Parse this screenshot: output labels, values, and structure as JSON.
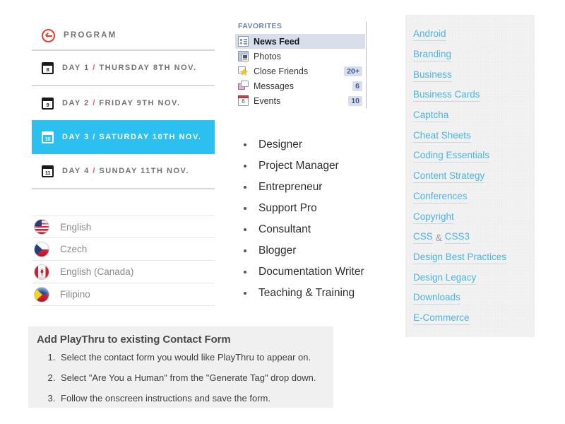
{
  "program": {
    "header": {
      "icon": "reply-arrow-circle-icon",
      "title": "PROGRAM"
    },
    "days": [
      {
        "num": "8",
        "day": "DAY 1",
        "sep": " / ",
        "date": "THURSDAY 8TH NOV.",
        "active": false
      },
      {
        "num": "9",
        "day": "DAY 2",
        "sep": " / ",
        "date": "FRIDAY 9TH NOV.",
        "active": false
      },
      {
        "num": "10",
        "day": "DAY 3",
        "sep": " / ",
        "date": "SATURDAY 10TH NOV.",
        "active": true
      },
      {
        "num": "11",
        "day": "DAY 4",
        "sep": " / ",
        "date": "SUNDAY 11TH NOV.",
        "active": false
      }
    ]
  },
  "languages": [
    {
      "name": "English",
      "flag": "flag-united-states-icon"
    },
    {
      "name": "Czech",
      "flag": "flag-czech-republic-icon"
    },
    {
      "name": "English (Canada)",
      "flag": "flag-canada-icon"
    },
    {
      "name": "Filipino",
      "flag": "flag-philippines-icon"
    }
  ],
  "favorites": {
    "title": "FAVORITES",
    "items": [
      {
        "label": "News Feed",
        "icon": "news-feed-icon",
        "badge": "",
        "active": true
      },
      {
        "label": "Photos",
        "icon": "photos-icon",
        "badge": "",
        "active": false
      },
      {
        "label": "Close Friends",
        "icon": "close-friends-icon",
        "badge": "20+",
        "active": false
      },
      {
        "label": "Messages",
        "icon": "messages-icon",
        "badge": "6",
        "active": false
      },
      {
        "label": "Events",
        "icon": "events-calendar-icon",
        "badge": "10",
        "active": false,
        "icon_num": "6"
      }
    ]
  },
  "roles": [
    "Designer",
    "Project Manager",
    "Entrepreneur",
    "Support Pro",
    "Consultant",
    "Blogger",
    "Documentation Writer",
    "Teaching & Training"
  ],
  "tags": [
    {
      "parts": [
        {
          "text": "Android",
          "link": true
        }
      ]
    },
    {
      "parts": [
        {
          "text": "Branding",
          "link": true
        }
      ]
    },
    {
      "parts": [
        {
          "text": "Business",
          "link": true
        }
      ]
    },
    {
      "parts": [
        {
          "text": "Business Cards",
          "link": true
        }
      ]
    },
    {
      "parts": [
        {
          "text": "Captcha",
          "link": true
        }
      ]
    },
    {
      "parts": [
        {
          "text": "Cheat Sheets",
          "link": true
        }
      ]
    },
    {
      "parts": [
        {
          "text": "Coding Essentials",
          "link": true
        }
      ]
    },
    {
      "parts": [
        {
          "text": "Content Strategy",
          "link": true
        }
      ]
    },
    {
      "parts": [
        {
          "text": "Conferences",
          "link": true
        }
      ]
    },
    {
      "parts": [
        {
          "text": "Copyright",
          "link": true
        }
      ]
    },
    {
      "parts": [
        {
          "text": "CSS",
          "link": true
        },
        {
          "text": "&",
          "link": false
        },
        {
          "text": "CSS3",
          "link": true
        }
      ]
    },
    {
      "parts": [
        {
          "text": "Design Best Practices",
          "link": true
        }
      ]
    },
    {
      "parts": [
        {
          "text": "Design Legacy",
          "link": true
        }
      ]
    },
    {
      "parts": [
        {
          "text": "Downloads",
          "link": true
        }
      ]
    },
    {
      "parts": [
        {
          "text": "E-Commerce",
          "link": true
        }
      ]
    }
  ],
  "instructions": {
    "title": "Add PlayThru to existing Contact Form",
    "steps": [
      "Select the contact form you would like PlayThru to appear on.",
      "Select \"Are You a Human\" from the \"Generate Tag\" drop down.",
      "Follow the onscreen instructions and save the form."
    ]
  },
  "colors": {
    "accent_blue": "#2bc0f0",
    "link_blue": "#4ab5e2",
    "red": "#ea3b2e",
    "fav_highlight": "#d8dfea",
    "fav_title": "#6d84b4"
  }
}
